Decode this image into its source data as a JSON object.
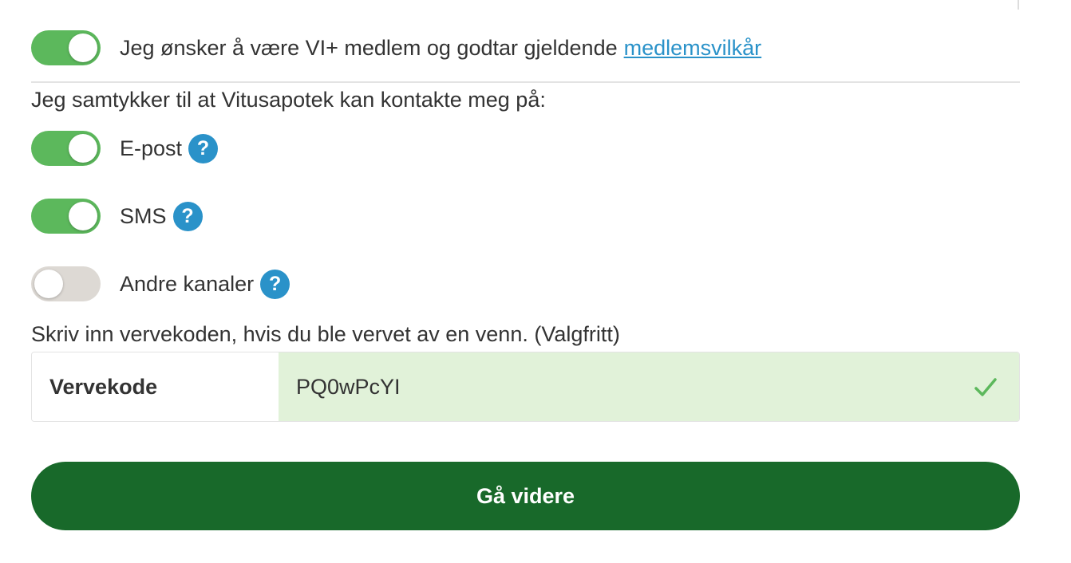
{
  "membership": {
    "toggle_on": true,
    "label": "Jeg ønsker å være VI+ medlem og godtar gjeldende",
    "link_text": "medlemsvilkår"
  },
  "consent": {
    "heading": "Jeg samtykker til at Vitusapotek kan kontakte meg på:",
    "channels": [
      {
        "label": "E-post",
        "on": true,
        "help_icon": "question-mark-icon",
        "help_symbol": "?"
      },
      {
        "label": "SMS",
        "on": true,
        "help_icon": "question-mark-icon",
        "help_symbol": "?"
      },
      {
        "label": "Andre kanaler",
        "on": false,
        "help_icon": "question-mark-icon",
        "help_symbol": "?"
      }
    ]
  },
  "referral": {
    "heading": "Skriv inn vervekoden, hvis du ble vervet av en venn. (Valgfritt)",
    "field_label": "Vervekode",
    "field_value": "PQ0wPcYI",
    "valid": true
  },
  "submit": {
    "label": "Gå videre"
  },
  "colors": {
    "toggle_on": "#5cb85c",
    "toggle_off": "#ddd9d4",
    "help_icon": "#2a92c9",
    "link": "#2a92c9",
    "valid_field_bg": "#e1f2d9",
    "check": "#5cb85c",
    "submit_bg": "#18692a"
  }
}
